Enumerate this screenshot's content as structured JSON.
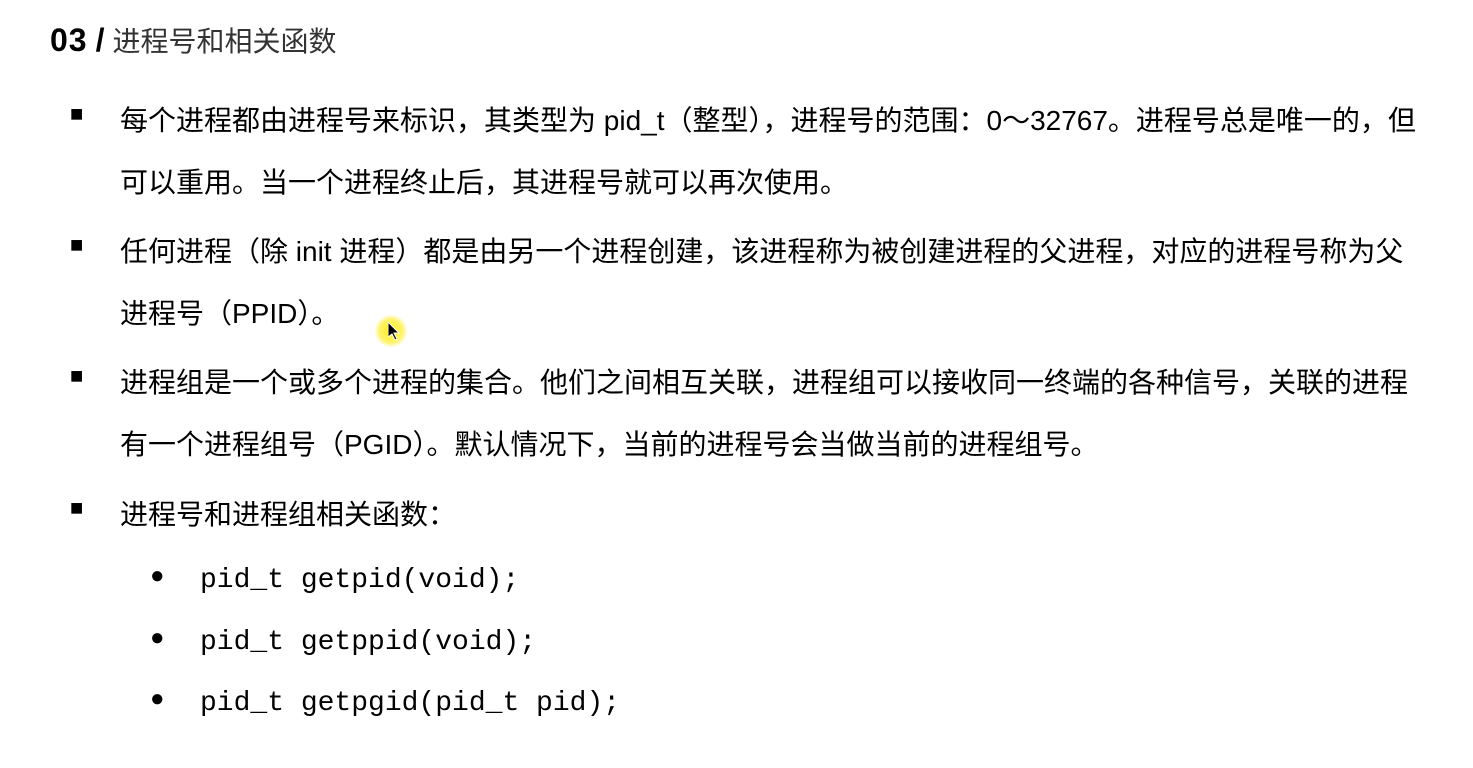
{
  "heading": {
    "number": "03",
    "slash": "/",
    "title": "进程号和相关函数"
  },
  "bullets": [
    "每个进程都由进程号来标识，其类型为 pid_t（整型），进程号的范围：0～32767。进程号总是唯一的，但可以重用。当一个进程终止后，其进程号就可以再次使用。",
    "任何进程（除 init 进程）都是由另一个进程创建，该进程称为被创建进程的父进程，对应的进程号称为父进程号（PPID）。",
    "进程组是一个或多个进程的集合。他们之间相互关联，进程组可以接收同一终端的各种信号，关联的进程有一个进程组号（PGID）。默认情况下，当前的进程号会当做当前的进程组号。",
    "进程号和进程组相关函数："
  ],
  "functions": [
    "pid_t getpid(void);",
    "pid_t getppid(void);",
    "pid_t getpgid(pid_t pid);"
  ]
}
